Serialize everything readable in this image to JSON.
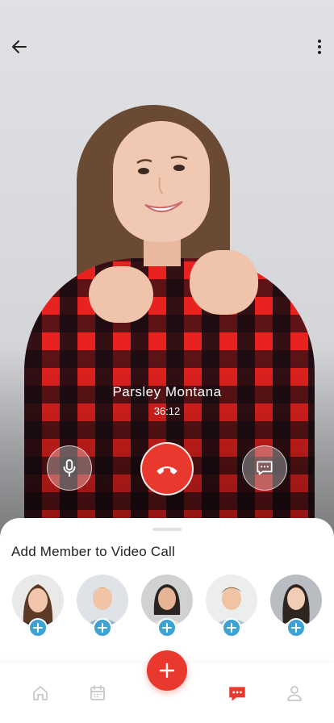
{
  "call": {
    "caller_name": "Parsley Montana",
    "duration": "36:12"
  },
  "icons": {
    "back": "arrow-left-icon",
    "more": "more-vertical-icon",
    "mic": "microphone-icon",
    "end_call": "phone-hangup-icon",
    "chat": "chat-bubble-icon",
    "add": "plus-icon",
    "home": "home-icon",
    "calendar": "calendar-icon",
    "messages": "messages-icon",
    "profile": "user-icon"
  },
  "sheet": {
    "title": "Add Member to Video Call"
  },
  "members": [
    {
      "avatar": "woman-brown-hair"
    },
    {
      "avatar": "man-blonde"
    },
    {
      "avatar": "woman-dark-hair"
    },
    {
      "avatar": "man-smiling"
    },
    {
      "avatar": "woman-long-dark-hair"
    }
  ],
  "colors": {
    "accent_red": "#e9392e",
    "add_blue": "#3fa1d4",
    "tab_inactive": "#c8c8c8"
  },
  "tabs": {
    "active": "messages"
  }
}
